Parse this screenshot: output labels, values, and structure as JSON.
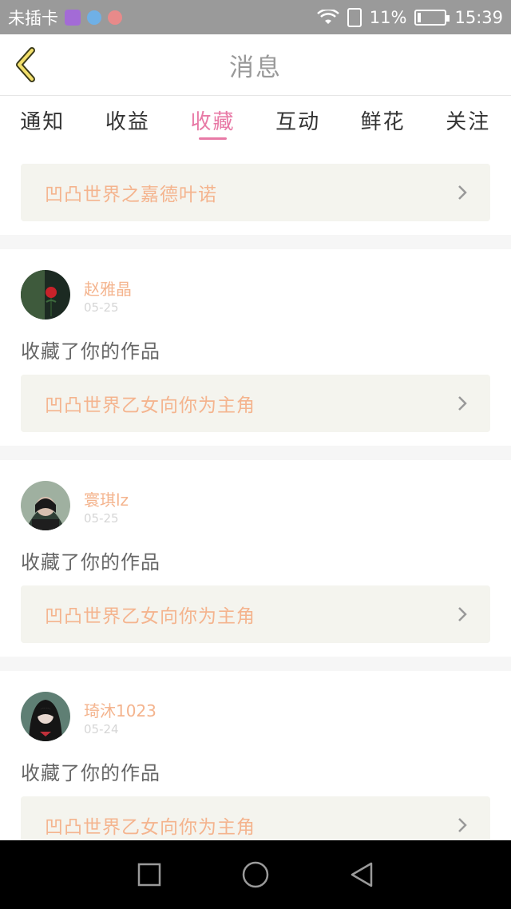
{
  "status_bar": {
    "carrier": "未插卡",
    "battery_percent": "11%",
    "battery_level": 0.11,
    "time": "15:39"
  },
  "header": {
    "title": "消息"
  },
  "tabs": [
    {
      "label": "通知"
    },
    {
      "label": "收益"
    },
    {
      "label": "收藏"
    },
    {
      "label": "互动"
    },
    {
      "label": "鲜花"
    },
    {
      "label": "关注"
    }
  ],
  "active_tab": 2,
  "feed": {
    "partial_item": {
      "work_title": "凹凸世界之嘉德叶诺"
    },
    "items": [
      {
        "username": "赵雅晶",
        "date": "05-25",
        "action": "收藏了你的作品",
        "work_title": "凹凸世界乙女向你为主角"
      },
      {
        "username": "寰琪lz",
        "date": "05-25",
        "action": "收藏了你的作品",
        "work_title": "凹凸世界乙女向你为主角"
      },
      {
        "username": "琦沐1023",
        "date": "05-24",
        "action": "收藏了你的作品",
        "work_title": "凹凸世界乙女向你为主角"
      }
    ]
  },
  "colors": {
    "accent": "#e87aa6",
    "username": "#f4b48e",
    "work_box_bg": "#f4f4ee",
    "status_bar_bg": "#9a9a9a"
  },
  "nav": {
    "icons": [
      "recent-apps-icon",
      "home-icon",
      "back-nav-icon"
    ]
  }
}
